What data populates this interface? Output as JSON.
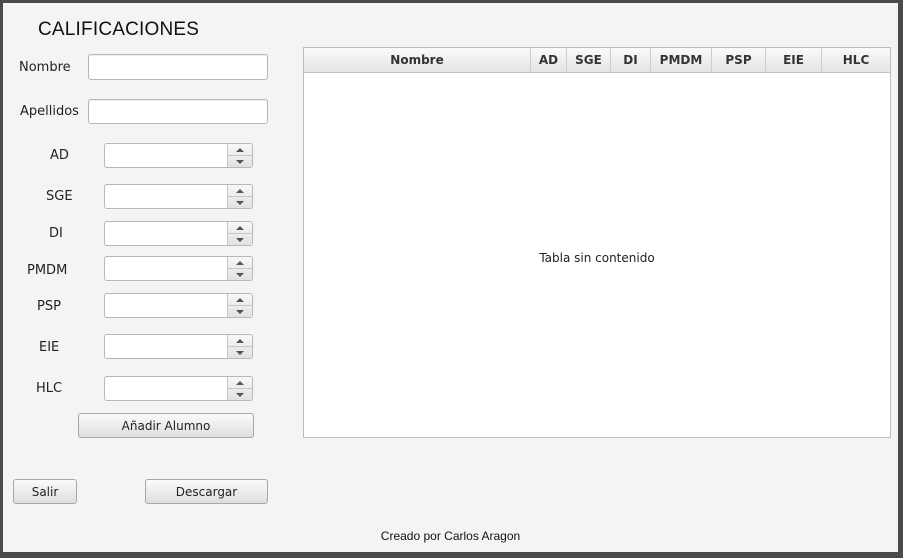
{
  "title": "CALIFICACIONES",
  "form": {
    "nombre_label": "Nombre",
    "nombre_value": "",
    "apellidos_label": "Apellidos",
    "apellidos_value": "",
    "subjects": [
      {
        "label": "AD",
        "value": ""
      },
      {
        "label": "SGE",
        "value": ""
      },
      {
        "label": "DI",
        "value": ""
      },
      {
        "label": "PMDM",
        "value": ""
      },
      {
        "label": "PSP",
        "value": ""
      },
      {
        "label": "EIE",
        "value": ""
      },
      {
        "label": "HLC",
        "value": ""
      }
    ],
    "add_button": "Añadir Alumno"
  },
  "table": {
    "columns": [
      "Nombre",
      "AD",
      "SGE",
      "DI",
      "PMDM",
      "PSP",
      "EIE",
      "HLC"
    ],
    "empty_text": "Tabla sin contenido"
  },
  "buttons": {
    "exit": "Salir",
    "download": "Descargar"
  },
  "footer": "Creado por Carlos Aragon"
}
